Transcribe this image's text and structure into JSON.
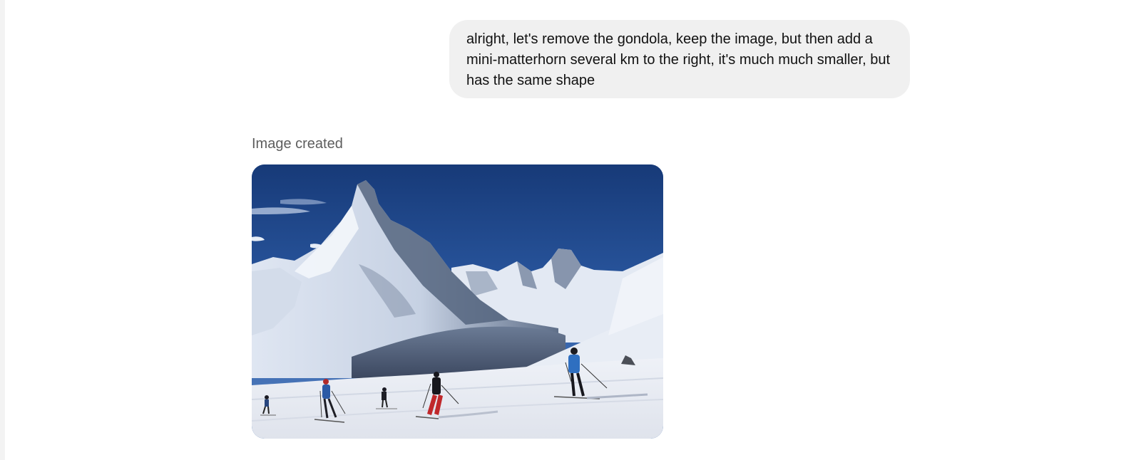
{
  "conversation": {
    "user_message": "alright, let's remove the gondola, keep the image, but then add a mini-matterhorn several km to the right, it's much much smaller, but has the same shape",
    "assistant": {
      "status_label": "Image created"
    }
  },
  "colors": {
    "user_bubble_bg": "#f0f0f0",
    "status_text": "#5d5d5d",
    "sky_top": "#1b3f7f",
    "sky_bottom": "#3f70b8",
    "snow": "#e9edf5"
  }
}
